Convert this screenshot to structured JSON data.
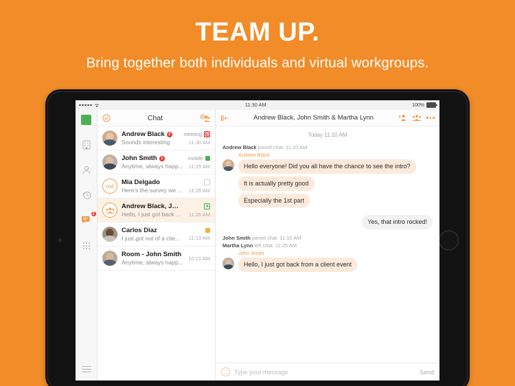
{
  "promo": {
    "title": "TEAM UP.",
    "subtitle": "Bring together both individuals and virtual workgroups.",
    "background_color": "#F28C28"
  },
  "status_bar": {
    "time": "11:30 AM",
    "battery_percent": "100%",
    "signal_icon": "signal-dots-icon",
    "wifi_icon": "wifi-icon",
    "battery_icon": "battery-icon"
  },
  "rail": {
    "logo_color": "#4CB050",
    "items": [
      {
        "name": "company",
        "icon": "building-icon",
        "active": false,
        "badge": ""
      },
      {
        "name": "contacts",
        "icon": "person-icon",
        "active": false,
        "badge": ""
      },
      {
        "name": "history",
        "icon": "clock-history-icon",
        "active": false,
        "badge": ""
      },
      {
        "name": "chat",
        "icon": "chat-bubble-icon",
        "active": true,
        "badge": "2"
      },
      {
        "name": "dialpad",
        "icon": "dialpad-icon",
        "active": false,
        "badge": ""
      }
    ],
    "menu_icon": "hamburger-menu-icon"
  },
  "chat_list": {
    "header": {
      "title": "Chat",
      "left_icon": "check-circle-icon",
      "right_icon": "add-group-icon"
    },
    "items": [
      {
        "name": "Andrew Black",
        "preview": "Sounds interesting",
        "time": "11:30 AM",
        "unread": "2",
        "status_label": "meeting",
        "status_type": "meeting",
        "avatar": "photo-male-1",
        "active": false
      },
      {
        "name": "John Smith",
        "preview": "Anytime, always happ...",
        "time": "11:29 AM",
        "unread": "1",
        "status_label": "mobile",
        "status_type": "green",
        "avatar": "photo-male-2",
        "active": false
      },
      {
        "name": "Mia Delgado",
        "preview": "Here's the survey we ...",
        "time": "11:26 AM",
        "unread": "",
        "status_label": "",
        "status_type": "empty",
        "avatar": "initials-md",
        "active": false
      },
      {
        "name": "Andrew Black, Jonh S...",
        "preview": "Hello, I just got back ...",
        "time": "11:26 AM",
        "unread": "",
        "status_label": "",
        "status_type": "lock",
        "avatar": "group",
        "active": true
      },
      {
        "name": "Carlos Diaz",
        "preview": "I just got out of a clie...",
        "time": "11:13 AM",
        "unread": "",
        "status_label": "",
        "status_type": "yellow",
        "avatar": "photo-male-3",
        "active": false
      },
      {
        "name": "Room - John Smith",
        "preview": "Anytime, always happ...",
        "time": "10:21 AM",
        "unread": "",
        "status_label": "",
        "status_type": "none",
        "avatar": "photo-male-4",
        "active": false
      }
    ]
  },
  "conversation": {
    "header": {
      "collapse_icon": "collapse-panel-icon",
      "title": "Andrew Black, John Smith & Martha Lynn",
      "add_person_icon": "add-person-icon",
      "group_icon": "group-people-icon",
      "more_icon": "more-options-icon"
    },
    "day_divider": "Today 11:10 AM",
    "events": [
      {
        "kind": "system",
        "actor": "Andrew Black",
        "text": " joined chat. 11:10 AM"
      },
      {
        "kind": "incoming",
        "sender": "Andrew Black",
        "avatar": "photo-male-1",
        "bubbles": [
          "Hello everyone! Did you all have the chance to see the intro?",
          "It is actually pretty good",
          "Especially the 1st part"
        ]
      },
      {
        "kind": "outgoing",
        "text": "Yes, that intro rocked!"
      },
      {
        "kind": "system",
        "actor": "John Smith",
        "text": " joined chat. 11:10 AM"
      },
      {
        "kind": "system",
        "actor": "Martha Lynn",
        "text": " left chat. 11:25 AM"
      },
      {
        "kind": "incoming",
        "sender": "John Smith",
        "avatar": "photo-male-2",
        "bubbles": [
          "Hello, I just got back from a client event"
        ]
      }
    ],
    "composer": {
      "emoji_icon": "smiley-icon",
      "placeholder": "Type your message",
      "send_label": "Send"
    }
  },
  "colors": {
    "accent": "#F2994A",
    "brand_orange": "#F28C28",
    "incoming_bubble": "#FBEADB",
    "outgoing_bubble": "#F2F2F2",
    "unread_badge": "#e8392e",
    "online_green": "#4CB050",
    "away_yellow": "#F2B134"
  }
}
